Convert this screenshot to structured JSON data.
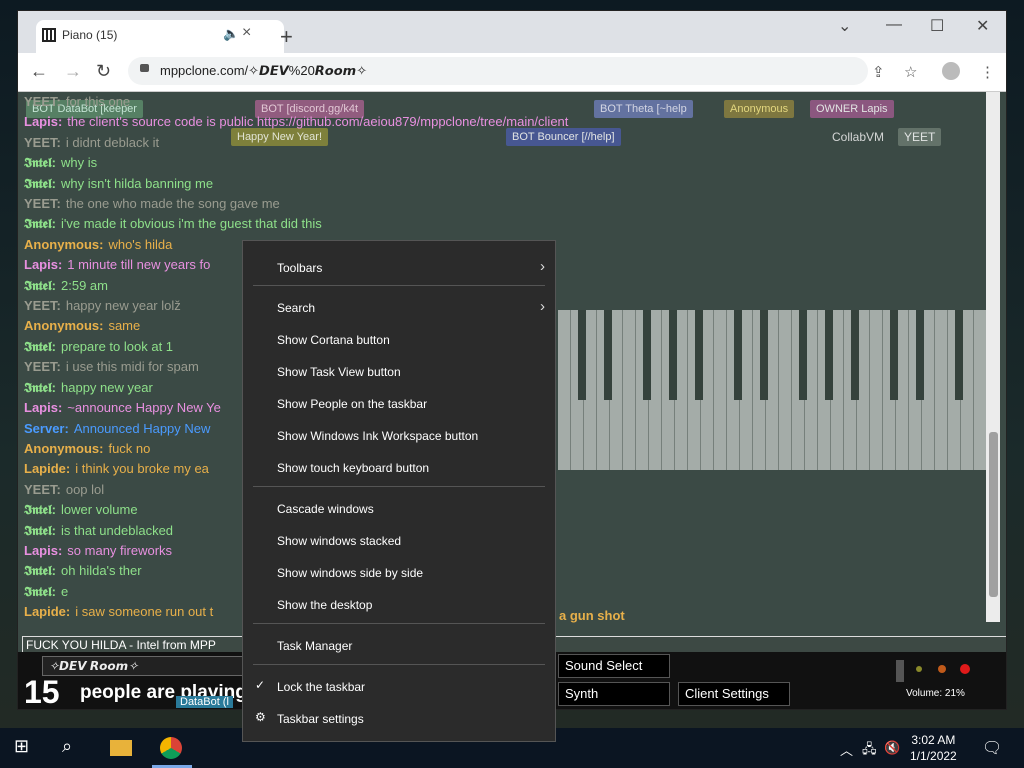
{
  "browser": {
    "tab_title": "Piano (15)",
    "tab_audio_icon": "speaker-icon",
    "tab_close": "×",
    "new_tab": "+",
    "url": "mppclone.com/✧𝘿𝙀𝙑%20𝙍𝙤𝙤𝙢✧"
  },
  "chat": [
    {
      "name": "YEET:",
      "text": "for this one",
      "color": "y"
    },
    {
      "name": "Lapis:",
      "text": "the client's source code is public https://github.com/aeiou879/mppclone/tree/main/client",
      "color": "p"
    },
    {
      "name": "YEET:",
      "text": "i didnt deblack it",
      "color": "y"
    },
    {
      "name": "𝕴𝖓𝖙𝖊𝖑:",
      "text": "why is",
      "color": "g"
    },
    {
      "name": "𝕴𝖓𝖙𝖊𝖑:",
      "text": "why isn't hilda banning me",
      "color": "g"
    },
    {
      "name": "YEET:",
      "text": "the one who made the song gave me",
      "color": "y"
    },
    {
      "name": "𝕴𝖓𝖙𝖊𝖑:",
      "text": "i've made it obvious i'm the guest that did this",
      "color": "g"
    },
    {
      "name": "Anonymous:",
      "text": "who's hilda",
      "color": "o"
    },
    {
      "name": "Lapis:",
      "text": "1 minute till new years fo",
      "color": "p"
    },
    {
      "name": "𝕴𝖓𝖙𝖊𝖑:",
      "text": "2:59 am",
      "color": "g"
    },
    {
      "name": "YEET:",
      "text": "happy new year lolž",
      "color": "y"
    },
    {
      "name": "Anonymous:",
      "text": "same",
      "color": "o"
    },
    {
      "name": "𝕴𝖓𝖙𝖊𝖑:",
      "text": "prepare to look at 1",
      "color": "g"
    },
    {
      "name": "YEET:",
      "text": "i use this midi for spam",
      "color": "y"
    },
    {
      "name": "𝕴𝖓𝖙𝖊𝖑:",
      "text": "happy new year",
      "color": "g"
    },
    {
      "name": "Lapis:",
      "text": "~announce Happy New Ye",
      "color": "p"
    },
    {
      "name": "Server:",
      "text": "Announced Happy New",
      "color": "b"
    },
    {
      "name": "Anonymous:",
      "text": "fuck no",
      "color": "o"
    },
    {
      "name": "Lapide:",
      "text": "i think you broke my ea",
      "color": "o"
    },
    {
      "name": "YEET:",
      "text": "oop lol",
      "color": "y"
    },
    {
      "name": "𝕴𝖓𝖙𝖊𝖑:",
      "text": "lower volume",
      "color": "g"
    },
    {
      "name": "𝕴𝖓𝖙𝖊𝖑:",
      "text": "is that undeblacked",
      "color": "g"
    },
    {
      "name": "Lapis:",
      "text": "so many fireworks",
      "color": "p"
    },
    {
      "name": "𝕴𝖓𝖙𝖊𝖑:",
      "text": "oh hilda's ther",
      "color": "g"
    },
    {
      "name": "𝕴𝖓𝖙𝖊𝖑:",
      "text": "e",
      "color": "g"
    },
    {
      "name": "Lapide:",
      "text": "i saw someone run out t",
      "color": "o"
    }
  ],
  "chat_tail": "a gun shot",
  "badges": {
    "databot": "BOT  DataBot [keeper",
    "discord": "BOT  [discord.gg/k4t",
    "theta": "BOT  Theta [~help",
    "anonymous": "Anonymous",
    "owner": "OWNER  Lapis",
    "bouncer": "BOT  Bouncer [//help]",
    "collabvm": "CollabVM",
    "yeet": "YEET",
    "happy": "Happy New Year!"
  },
  "chat_input": "FUCK YOU HILDA - Intel from MPP",
  "room": {
    "name": "✧𝘿𝙀𝙑 𝙍𝙤𝙤𝙢✧",
    "count": "15",
    "people_text": "people are playing",
    "bot_label": "DataBot (l",
    "sound_select": "Sound Select",
    "synth": "Synth",
    "client_settings": "Client Settings",
    "volume": "Volume: 21%"
  },
  "context_menu": [
    {
      "label": "Toolbars",
      "submenu": true
    },
    {
      "label": "Search",
      "submenu": true
    },
    {
      "label": "Show Cortana button"
    },
    {
      "label": "Show Task View button"
    },
    {
      "label": "Show People on the taskbar"
    },
    {
      "label": "Show Windows Ink Workspace button"
    },
    {
      "label": "Show touch keyboard button"
    },
    {
      "label": "Cascade windows"
    },
    {
      "label": "Show windows stacked"
    },
    {
      "label": "Show windows side by side"
    },
    {
      "label": "Show the desktop"
    },
    {
      "label": "Task Manager"
    },
    {
      "label": "Lock the taskbar",
      "checked": true
    },
    {
      "label": "Taskbar settings",
      "icon": "gear-icon"
    }
  ],
  "taskbar": {
    "time": "3:02 AM",
    "date": "1/1/2022"
  },
  "colors": {
    "menu_bg": "#2b2b2b",
    "page_bg": "#3b4a45",
    "taskbar_bg": "#0b1522"
  }
}
